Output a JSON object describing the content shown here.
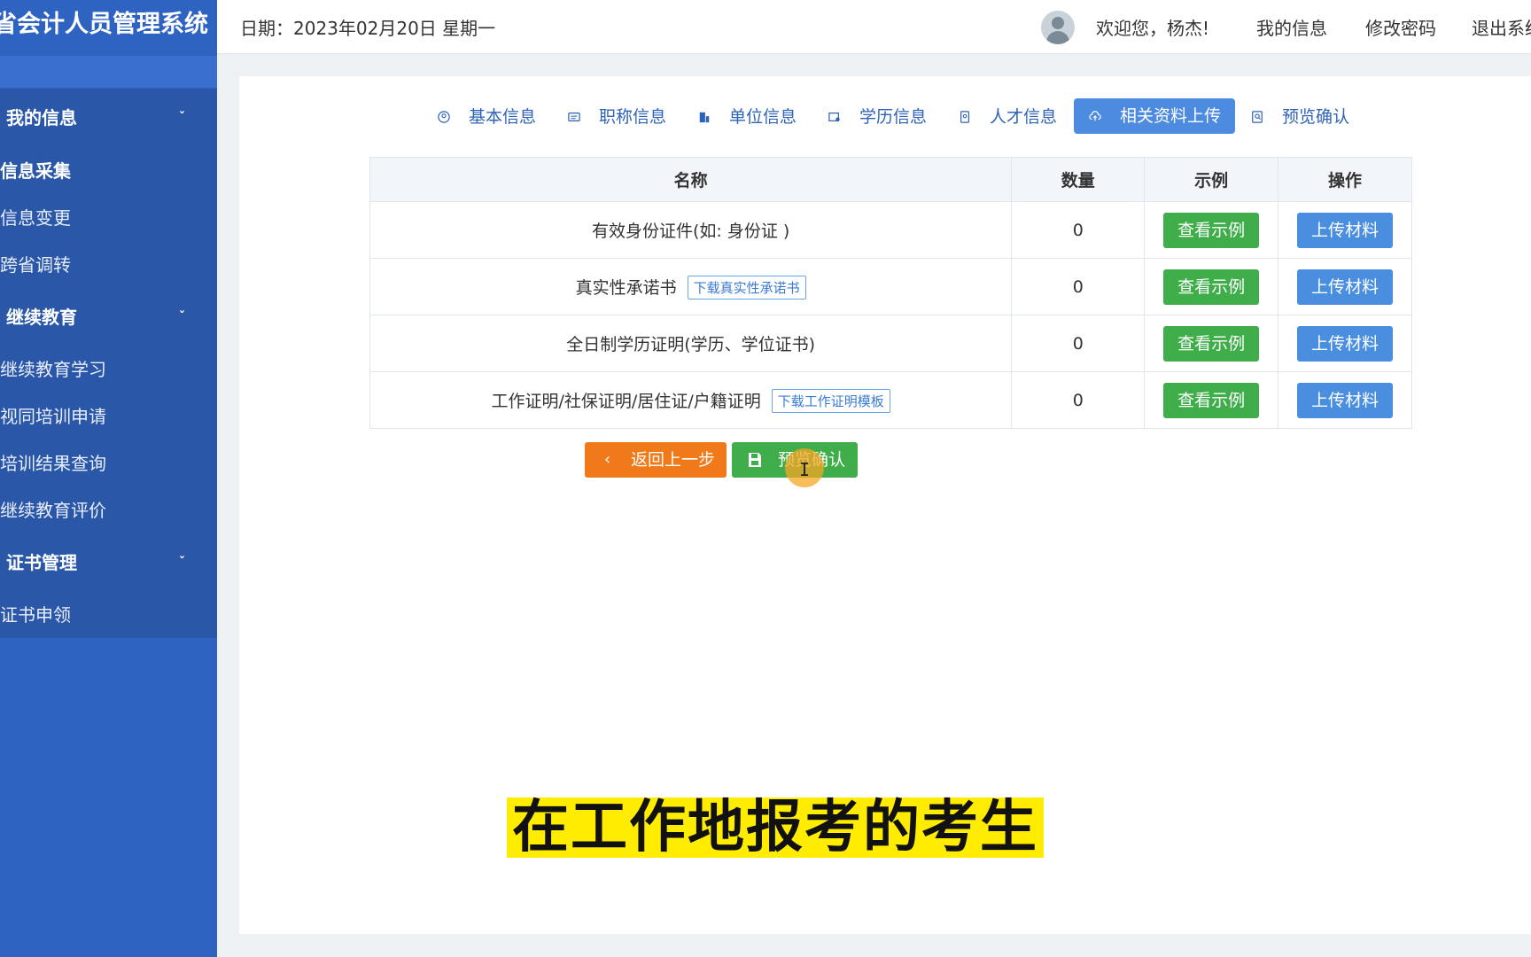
{
  "app": {
    "title": "省会计人员管理系统"
  },
  "header": {
    "date": "日期：2023年02月20日 星期一",
    "welcome": "欢迎您，杨杰!",
    "links": [
      "我的信息",
      "修改密码",
      "退出系统"
    ]
  },
  "sidebar": {
    "groups": [
      {
        "label": "我的信息",
        "items": [
          "信息采集",
          "信息变更",
          "跨省调转"
        ]
      },
      {
        "label": "继续教育",
        "items": [
          "继续教育学习",
          "视同培训申请",
          "培训结果查询",
          "继续教育评价"
        ]
      },
      {
        "label": "证书管理",
        "items": [
          "证书申领"
        ]
      }
    ]
  },
  "steps": [
    "基本信息",
    "职称信息",
    "单位信息",
    "学历信息",
    "人才信息",
    "相关资料上传",
    "预览确认"
  ],
  "active_step": "相关资料上传",
  "table": {
    "headers": [
      "名称",
      "数量",
      "示例",
      "操作"
    ],
    "rows": [
      {
        "name": "有效身份证件(如: 身份证 )",
        "download": "",
        "count": "0",
        "example": "查看示例",
        "action": "上传材料"
      },
      {
        "name": "真实性承诺书",
        "download": "下载真实性承诺书",
        "count": "0",
        "example": "查看示例",
        "action": "上传材料"
      },
      {
        "name": "全日制学历证明(学历、学位证书)",
        "download": "",
        "count": "0",
        "example": "查看示例",
        "action": "上传材料"
      },
      {
        "name": "工作证明/社保证明/居住证/户籍证明",
        "download": "下载工作证明模板",
        "count": "0",
        "example": "查看示例",
        "action": "上传材料"
      }
    ]
  },
  "buttons": {
    "back": "返回上一步",
    "preview": "预览确认"
  },
  "subtitle": "在工作地报考的考生",
  "colors": {
    "sidebar": "#2f63c2",
    "active_tab": "#4d8be0",
    "green": "#3fae4a",
    "blue": "#4a8ee0",
    "orange": "#f07a1a",
    "caption_bg": "#ffec00"
  }
}
